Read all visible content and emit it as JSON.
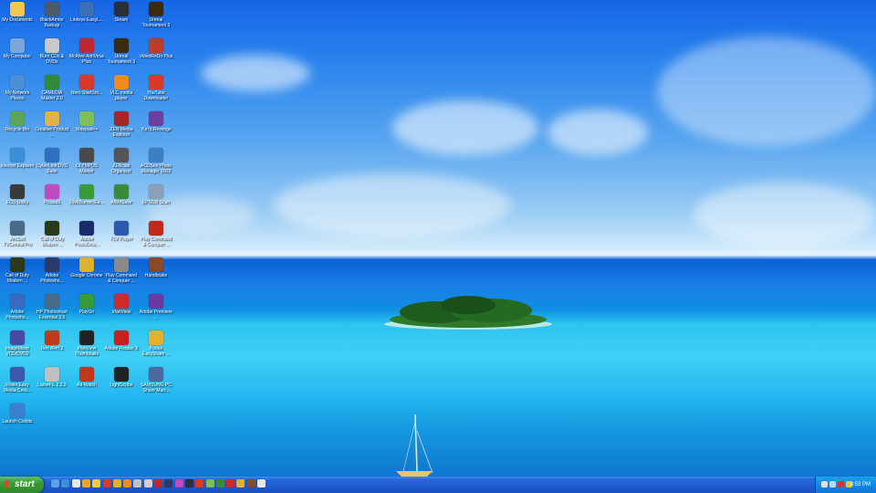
{
  "desktop": {
    "icons": [
      {
        "label": "My Documents",
        "icon": "folder-docs-icon",
        "color": "#f2c94c"
      },
      {
        "label": "BlackArmor Backup",
        "icon": "backup-icon",
        "color": "#4a5a6a"
      },
      {
        "label": "Linksys EasyL...",
        "icon": "linksys-icon",
        "color": "#3b6fb6"
      },
      {
        "label": "Steam",
        "icon": "steam-icon",
        "color": "#2a2f3a"
      },
      {
        "label": "Unreal Tournament 3",
        "icon": "unreal-icon",
        "color": "#3a2a10"
      },
      {
        "label": "My Computer",
        "icon": "computer-icon",
        "color": "#7aa7d9"
      },
      {
        "label": "Burn CDs & DVDs",
        "icon": "disc-icon",
        "color": "#c9c9c9"
      },
      {
        "label": "McAfee AntiVirus Plus",
        "icon": "mcafee-icon",
        "color": "#c0282d"
      },
      {
        "label": "Unreal Tournament 3",
        "icon": "unreal-icon",
        "color": "#3a2a10"
      },
      {
        "label": "VideoReDo Plus",
        "icon": "videoredo-icon",
        "color": "#c23b2a"
      },
      {
        "label": "My Network Places",
        "icon": "network-icon",
        "color": "#4c8fd6"
      },
      {
        "label": "CAMEDIA Master 2.0",
        "icon": "camedia-icon",
        "color": "#2f8a3a"
      },
      {
        "label": "Nero StartSm...",
        "icon": "nero-icon",
        "color": "#d8392b"
      },
      {
        "label": "VLC media player",
        "icon": "vlc-icon",
        "color": "#f28a1e"
      },
      {
        "label": "YouTube Downloader",
        "icon": "youtube-icon",
        "color": "#d8392b"
      },
      {
        "label": "Recycle Bin",
        "icon": "recycle-bin-icon",
        "color": "#5aa55a"
      },
      {
        "label": "Creative Product ...",
        "icon": "creative-icon",
        "color": "#e0b34a"
      },
      {
        "label": "Notepad++",
        "icon": "notepad-icon",
        "color": "#7fbf5a"
      },
      {
        "label": "ZEN Media Explorer",
        "icon": "zen-icon",
        "color": "#a02828"
      },
      {
        "label": "Yuri's Revenge",
        "icon": "yuri-icon",
        "color": "#6a3fa0"
      },
      {
        "label": "Internet Explorer",
        "icon": "ie-icon",
        "color": "#3a8fd6"
      },
      {
        "label": "CyberLink DVD Suite",
        "icon": "cyberlink-icon",
        "color": "#2f6fc0"
      },
      {
        "label": "OLYMPUS Master",
        "icon": "olympus-icon",
        "color": "#4a4a4a"
      },
      {
        "label": "ZENcast Organizer",
        "icon": "zencast-icon",
        "color": "#555555"
      },
      {
        "label": "ACDSee Photo Manager 2009",
        "icon": "acdsee-icon",
        "color": "#3a7fc0"
      },
      {
        "label": "EOS Utility",
        "icon": "eos-icon",
        "color": "#3a3a3a"
      },
      {
        "label": "Picasa3",
        "icon": "picasa-icon",
        "color": "#c04ac0"
      },
      {
        "label": "DivXBurner/Ea...",
        "icon": "divx-icon",
        "color": "#3a9a3a"
      },
      {
        "label": "AIMeSave",
        "icon": "aim-icon",
        "color": "#3a8a3a"
      },
      {
        "label": "EPSON Scan",
        "icon": "scanner-icon",
        "color": "#8aa0b8"
      },
      {
        "label": "ArcSoft TVCentral Pro",
        "icon": "arcsoft-icon",
        "color": "#4a6a8a"
      },
      {
        "label": "Call of Duty Modern ...",
        "icon": "cod-icon",
        "color": "#2a3a1a"
      },
      {
        "label": "Adobe PhotoDelu...",
        "icon": "photodeluxe-icon",
        "color": "#1a2a6a"
      },
      {
        "label": "FLV Player",
        "icon": "flv-icon",
        "color": "#2a5ab0"
      },
      {
        "label": "Play Command & Conquer ...",
        "icon": "cnc-icon",
        "color": "#c02a1a"
      },
      {
        "label": "Call of Duty Modern ...",
        "icon": "cod-icon",
        "color": "#2a3a1a"
      },
      {
        "label": "Adobe Photosho...",
        "icon": "photoshop-icon",
        "color": "#2a3a6a"
      },
      {
        "label": "Google Chrome",
        "icon": "chrome-icon",
        "color": "#e0b030"
      },
      {
        "label": "Play Command & Conquer ...",
        "icon": "cnc-icon",
        "color": "#8a8a8a"
      },
      {
        "label": "Handbrake",
        "icon": "handbrake-icon",
        "color": "#8a4a2a"
      },
      {
        "label": "Adobe Photosho...",
        "icon": "photoshop-elements-icon",
        "color": "#3a6ac0"
      },
      {
        "label": "HP Photosmart Essential 3.5",
        "icon": "hp-icon",
        "color": "#4a6a8a"
      },
      {
        "label": "PlayOn",
        "icon": "playon-icon",
        "color": "#3a9a3a"
      },
      {
        "label": "IrfanView",
        "icon": "irfanview-icon",
        "color": "#d02a2a"
      },
      {
        "label": "Adobe Premiere ...",
        "icon": "premiere-icon",
        "color": "#6a3aa0"
      },
      {
        "label": "ImageMixer VCD/DVD2",
        "icon": "imagemixer-icon",
        "color": "#4a4aa0"
      },
      {
        "label": "Red Alert 2",
        "icon": "redalert-icon",
        "color": "#c03a1a"
      },
      {
        "label": "IrfanView Thumbnails",
        "icon": "panda-icon",
        "color": "#222222"
      },
      {
        "label": "Adobe Reader 9",
        "icon": "adobe-reader-icon",
        "color": "#c8201a"
      },
      {
        "label": "Kodak EasyShare ...",
        "icon": "kodak-icon",
        "color": "#e8b02a"
      },
      {
        "label": "Roxio Easy Media Crea...",
        "icon": "roxio-icon",
        "color": "#3a5ab0"
      },
      {
        "label": "LameFE 2.2.3",
        "icon": "lamefe-icon",
        "color": "#c0c0c0"
      },
      {
        "label": "Ad-Watch",
        "icon": "adwatch-icon",
        "color": "#c03a1a"
      },
      {
        "label": "LightScribe",
        "icon": "lightscribe-icon",
        "color": "#222222"
      },
      {
        "label": "SAMSUNG PC Share Man...",
        "icon": "samsung-icon",
        "color": "#4a6aa0"
      },
      {
        "label": "Launch Coolits",
        "icon": "coolits-icon",
        "color": "#3a7fd0"
      }
    ]
  },
  "taskbar": {
    "start_label": "start",
    "quick_launch": [
      {
        "icon": "show-desktop-icon",
        "color": "#5aa0e8"
      },
      {
        "icon": "ie-icon",
        "color": "#3a8fd6"
      },
      {
        "icon": "mail-icon",
        "color": "#e8e8e8"
      },
      {
        "icon": "media-player-icon",
        "color": "#f0a030"
      },
      {
        "icon": "folder-icon",
        "color": "#f2c94c"
      },
      {
        "icon": "nero-icon",
        "color": "#d8392b"
      },
      {
        "icon": "chrome-icon",
        "color": "#e0b030"
      },
      {
        "icon": "vlc-icon",
        "color": "#f28a1e"
      },
      {
        "icon": "calculator-icon",
        "color": "#c0c0c0"
      },
      {
        "icon": "disc-icon",
        "color": "#d0d0d0"
      },
      {
        "icon": "mcafee-icon",
        "color": "#c0282d"
      },
      {
        "icon": "photoshop-icon",
        "color": "#2a3a6a"
      },
      {
        "icon": "picasa-icon",
        "color": "#c04ac0"
      },
      {
        "icon": "steam-icon",
        "color": "#2a2f3a"
      },
      {
        "icon": "youtube-icon",
        "color": "#d8392b"
      },
      {
        "icon": "notepad-icon",
        "color": "#7fbf5a"
      },
      {
        "icon": "aim-icon",
        "color": "#3a8a3a"
      },
      {
        "icon": "irfanview-icon",
        "color": "#d02a2a"
      },
      {
        "icon": "kodak-icon",
        "color": "#e8b02a"
      },
      {
        "icon": "handbrake-icon",
        "color": "#8a4a2a"
      },
      {
        "icon": "document-icon",
        "color": "#e8e8e8"
      }
    ],
    "tray_icons": [
      {
        "icon": "network-tray-icon",
        "color": "#e0e0e0"
      },
      {
        "icon": "volume-icon",
        "color": "#c0d8f0"
      },
      {
        "icon": "security-icon",
        "color": "#d03a2a"
      },
      {
        "icon": "update-icon",
        "color": "#f0c030"
      }
    ],
    "clock": "9:53 PM"
  }
}
